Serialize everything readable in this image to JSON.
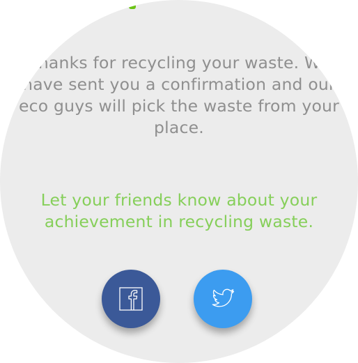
{
  "confirmation": {
    "lines": [
      "Thanks for recycling your waste. We",
      "have sent you a confirmation and our",
      "eco guys will pick the waste from your",
      "place."
    ]
  },
  "share": {
    "lines": [
      "Let your friends know about your",
      "achievement in recycling waste."
    ]
  },
  "buttons": {
    "facebook": {
      "icon": "facebook-icon",
      "color": "#3b5998"
    },
    "twitter": {
      "icon": "twitter-icon",
      "color": "#3c9cf0"
    }
  },
  "colors": {
    "background_circle": "#ececec",
    "accent_green": "#6cc417",
    "share_text": "#86cf5a",
    "message_text": "#8f8f8f"
  }
}
